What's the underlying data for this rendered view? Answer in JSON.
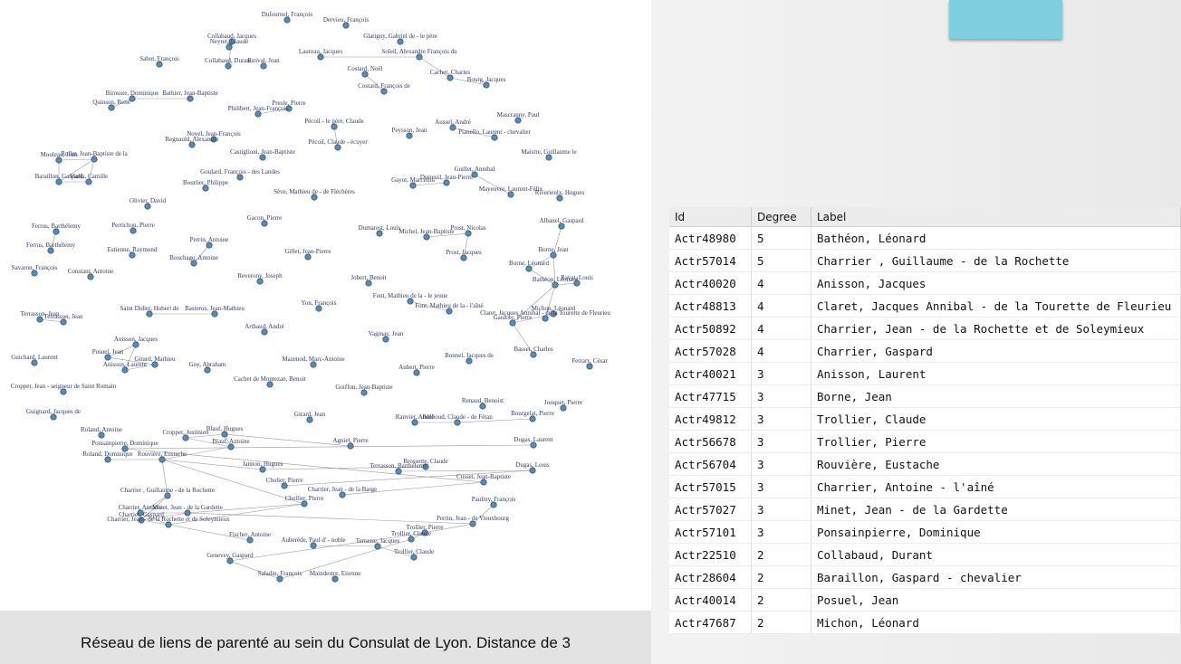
{
  "caption": "Réseau de liens de parenté au sein du Consulat de Lyon. Distance de 3",
  "colors": {
    "node_fill": "#5b8ab3",
    "node_stroke": "#2f587b",
    "edge": "#9a9a9a",
    "accent_box": "#7fcfe0"
  },
  "table": {
    "headers": [
      "Id",
      "Degree",
      "Label"
    ],
    "rows": [
      [
        "Actr48980",
        "5",
        "Bathéon, Léonard"
      ],
      [
        "Actr57014",
        "5",
        "Charrier , Guillaume - de la Rochette"
      ],
      [
        "Actr40020",
        "4",
        "Anisson, Jacques"
      ],
      [
        "Actr48813",
        "4",
        "Claret, Jacques Annibal - de la Tourette de Fleurieu"
      ],
      [
        "Actr50892",
        "4",
        "Charrier, Jean - de la Rochette et de Soleymieux"
      ],
      [
        "Actr57028",
        "4",
        "Charrier, Gaspard"
      ],
      [
        "Actr40021",
        "3",
        "Anisson, Laurent"
      ],
      [
        "Actr47715",
        "3",
        "Borne, Jean"
      ],
      [
        "Actr49812",
        "3",
        "Trollier, Claude"
      ],
      [
        "Actr56678",
        "3",
        "Trollier, Pierre"
      ],
      [
        "Actr56704",
        "3",
        "Rouvière, Eustache"
      ],
      [
        "Actr57015",
        "3",
        "Charrier, Antoine - l'aîné"
      ],
      [
        "Actr57027",
        "3",
        "Minet, Jean - de la Gardette"
      ],
      [
        "Actr57101",
        "3",
        "Ponsainpierre, Dominique"
      ],
      [
        "Actr22510",
        "2",
        "Collabaud, Durant"
      ],
      [
        "Actr28604",
        "2",
        "Baraillon, Gaspard - chevalier"
      ],
      [
        "Actr40014",
        "2",
        "Posuel, Jean"
      ],
      [
        "Actr47687",
        "2",
        "Michon, Léonard"
      ]
    ]
  },
  "graph": {
    "nodes": [
      "Dufournel, François",
      "Dervieu, François",
      "Collabaud, Jacques",
      "Glatigny, Gabriel de - le père",
      "Neyret, Claude",
      "Laureau, Jacques",
      "Soleil, Alexandre François du",
      "Sabot, François",
      "Collabaud, Durant",
      "Estival, Jean",
      "Costard, Noël",
      "Cachet, Charles",
      "Bourg, Jacques",
      "Costard, François de",
      "Birouste, Dominique",
      "Bathier, Jean-Baptiste",
      "Quinson, Rene",
      "Presle, Pierre",
      "Philibert, Jean-François",
      "Mascranny, Paul",
      "Pécoil - le père, Claude",
      "Aussel, André",
      "Peysson, Jean",
      "Pianello, Laurent - chevalier",
      "Noyel, Jean-François",
      "Regnauld, Alexandre",
      "Pécoil, Claude - écuyer",
      "Castiglioni, Jean-Baptiste",
      "Maistre, Guillaume le",
      "Mouleau, Jean",
      "Rollet, Jean-Baptiste de la",
      "Baraillon, Gaspard",
      "Vialla, Camille",
      "Goulard, François - des Landes",
      "Guillet, Annibal",
      "Bourlier, Philippe",
      "Gayot, Marcellin",
      "Dutreuil, Jean-Pierre",
      "Sève, Mathieu de - de Fléchères",
      "Mayeuvre, Laurent-Félix",
      "Riverieulx, Hugues",
      "Olivier, David",
      "Ferrus, Barthélemy",
      "Perrichon, Pierre",
      "Gacon, Pierre",
      "Albanel, Gaspard",
      "Dumarest, Louis",
      "Michel, Jean-Baptiste",
      "Prost, Nicolas",
      "Ferrus, Barthélemy",
      "Perrin, Antoine",
      "Estienne, Raymond",
      "Gillet, Jean-Pierre",
      "Borne, Jean",
      "Prost, Jacques",
      "Bouchage, Antoine",
      "Borne, Léonard",
      "Savaron, François",
      "Constant, Antoine",
      "Reverony, Joseph",
      "Jobert, Benoit",
      "Bathéon, Léonard",
      "Ravat, Louis",
      "Font, Mathieu de la - le jeune",
      "Yon, François",
      "Font, Mathieu de la - l'aîné",
      "Michon, Léonard",
      "Saint Didier, Hubert de",
      "Basteros, Jean-Mathieu",
      "Claret, Jacques Annibal - de la Tourette de Fleurieu",
      "Terrasson, Jean",
      "Terrasson, Jean",
      "Gaultier, Pierre",
      "Arthaud, André",
      "Vaginay, Jean",
      "Anisson, Jacques",
      "Posuel, Jean",
      "Basset, Charles",
      "Guichard, Laurent",
      "Girard, Mathieu",
      "Mazenod, Marc-Antoine",
      "Bonnel, Jacques de",
      "Ferrary, César",
      "Anisson, Laurent",
      "Goy, Abraham",
      "Aubert, Pierre",
      "Croppet, Jean - seigneur de Saint Romain",
      "Cachet de Montezan, Benoit",
      "Goiffon, Jean-Baptiste",
      "Renaud, Benoist",
      "Jonquet, Pierre",
      "Guignard, Jacques de",
      "Girard, Jean",
      "Ranvier, André",
      "Bollioud, Claude - de Fétan",
      "Bourgelat, Pierre",
      "Roland, Antoine",
      "Croppet, Justinien",
      "Blauf, Hugues",
      "Agniel, Pierre",
      "Dugas, Laurent",
      "Ponsainpierre, Dominique",
      "Blauf, Antoine",
      "Roland, Dominique",
      "Rouvière, Eustache",
      "Brossette, Claude",
      "Jannon, Hugues",
      "Terrasson, Barthélemy",
      "Dugas, Louis",
      "Cusset, Jean-Baptiste",
      "Cholier, Pierre",
      "Charrier , Guillaume - de la Rochette",
      "Charrier, Jean - de la Barge",
      "Chollier, Pierre",
      "Pauliny, François",
      "Charrier, Antoine",
      "Minet, Jean - de la Gardette",
      "Charrier, Gaspard",
      "Perrin, Jean - de Vieuxbourg",
      "Charrier, Jean - de la Rochette et de Soleymieux",
      "Trollier, Pierre",
      "Fischer, Antoine",
      "Trollier, Claude",
      "Auberède, Paul d' - noble",
      "Terrasse, Jacques",
      "Genevey, Gaspard",
      "Trollier, Claude",
      "Saladin, François",
      "Maindestre, Etienne"
    ]
  }
}
